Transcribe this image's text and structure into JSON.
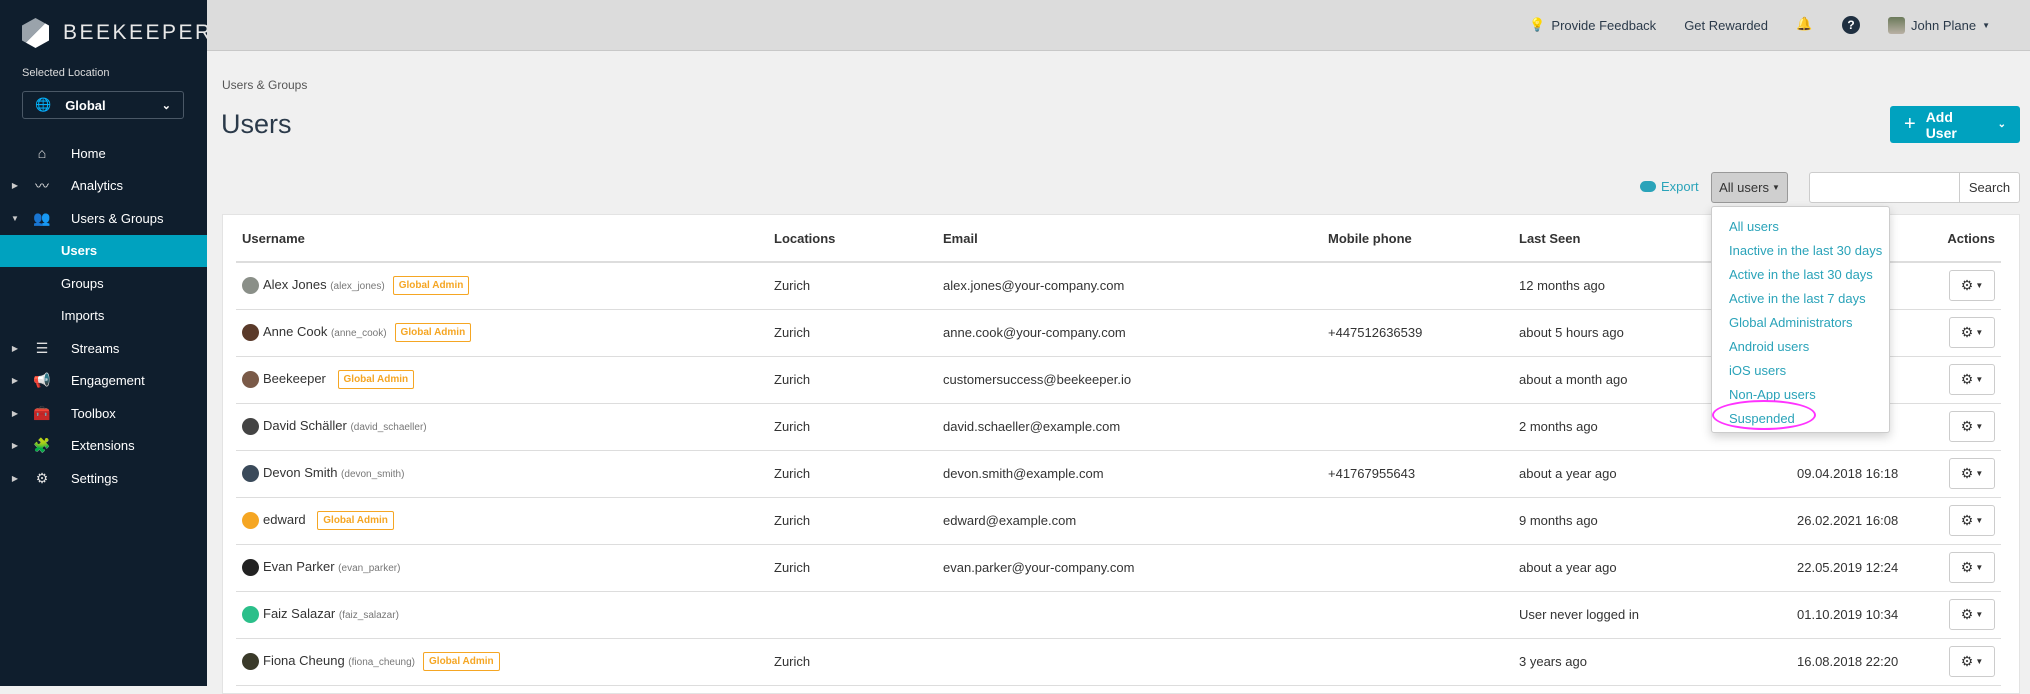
{
  "brand": "BEEKEEPER",
  "sidebar": {
    "location_label": "Selected Location",
    "location_value": "Global",
    "items": [
      {
        "label": "Home"
      },
      {
        "label": "Analytics"
      },
      {
        "label": "Users & Groups"
      },
      {
        "label": "Users"
      },
      {
        "label": "Groups"
      },
      {
        "label": "Imports"
      },
      {
        "label": "Streams"
      },
      {
        "label": "Engagement"
      },
      {
        "label": "Toolbox"
      },
      {
        "label": "Extensions"
      },
      {
        "label": "Settings"
      }
    ]
  },
  "topbar": {
    "feedback": "Provide Feedback",
    "rewarded": "Get Rewarded",
    "help": "?",
    "user": "John Plane"
  },
  "breadcrumb": "Users & Groups",
  "title": "Users",
  "add_user": "Add User",
  "toolbar": {
    "export": "Export",
    "filter": "All users",
    "search_value": "",
    "search_button": "Search"
  },
  "filter_options": [
    "All users",
    "Inactive in the last 30 days",
    "Active in the last 30 days",
    "Active in the last 7 days",
    "Global Administrators",
    "Android users",
    "iOS users",
    "Non-App users",
    "Suspended"
  ],
  "table": {
    "headers": {
      "username": "Username",
      "locations": "Locations",
      "email": "Email",
      "mobile": "Mobile phone",
      "last_seen": "Last Seen",
      "created": "",
      "actions": "Actions"
    },
    "badge": "Global Admin",
    "rows": [
      {
        "name": "Alex Jones",
        "handle": "(alex_jones)",
        "admin": true,
        "location": "Zurich",
        "email": "alex.jones@your-company.com",
        "mobile": "",
        "last_seen": "12 months ago",
        "created": "",
        "avatar": "#8a8f88"
      },
      {
        "name": "Anne Cook",
        "handle": "(anne_cook)",
        "admin": true,
        "location": "Zurich",
        "email": "anne.cook@your-company.com",
        "mobile": "+447512636539",
        "last_seen": "about 5 hours ago",
        "created": "",
        "avatar": "#5a3a2a"
      },
      {
        "name": "Beekeeper",
        "handle": "",
        "admin": true,
        "location": "Zurich",
        "email": "customersuccess@beekeeper.io",
        "mobile": "",
        "last_seen": "about a month ago",
        "created": "",
        "avatar": "#7a5a48"
      },
      {
        "name": "David Schäller",
        "handle": "(david_schaeller)",
        "admin": false,
        "location": "Zurich",
        "email": "david.schaeller@example.com",
        "mobile": "",
        "last_seen": "2 months ago",
        "created": "",
        "avatar": "#444"
      },
      {
        "name": "Devon Smith",
        "handle": "(devon_smith)",
        "admin": false,
        "location": "Zurich",
        "email": "devon.smith@example.com",
        "mobile": "+41767955643",
        "last_seen": "about a year ago",
        "created": "09.04.2018 16:18",
        "avatar": "#3a4a5a"
      },
      {
        "name": "edward",
        "handle": "",
        "admin": true,
        "location": "Zurich",
        "email": "edward@example.com",
        "mobile": "",
        "last_seen": "9 months ago",
        "created": "26.02.2021 16:08",
        "avatar": "#f5a623"
      },
      {
        "name": "Evan Parker",
        "handle": "(evan_parker)",
        "admin": false,
        "location": "Zurich",
        "email": "evan.parker@your-company.com",
        "mobile": "",
        "last_seen": "about a year ago",
        "created": "22.05.2019 12:24",
        "avatar": "#222"
      },
      {
        "name": "Faiz Salazar",
        "handle": "(faiz_salazar)",
        "admin": false,
        "location": "",
        "email": "",
        "mobile": "",
        "last_seen": "User never logged in",
        "created": "01.10.2019 10:34",
        "avatar": "#2bbf8a"
      },
      {
        "name": "Fiona Cheung",
        "handle": "(fiona_cheung)",
        "admin": true,
        "location": "Zurich",
        "email": "",
        "mobile": "",
        "last_seen": "3 years ago",
        "created": "16.08.2018 22:20",
        "avatar": "#3a3a2a"
      }
    ]
  }
}
